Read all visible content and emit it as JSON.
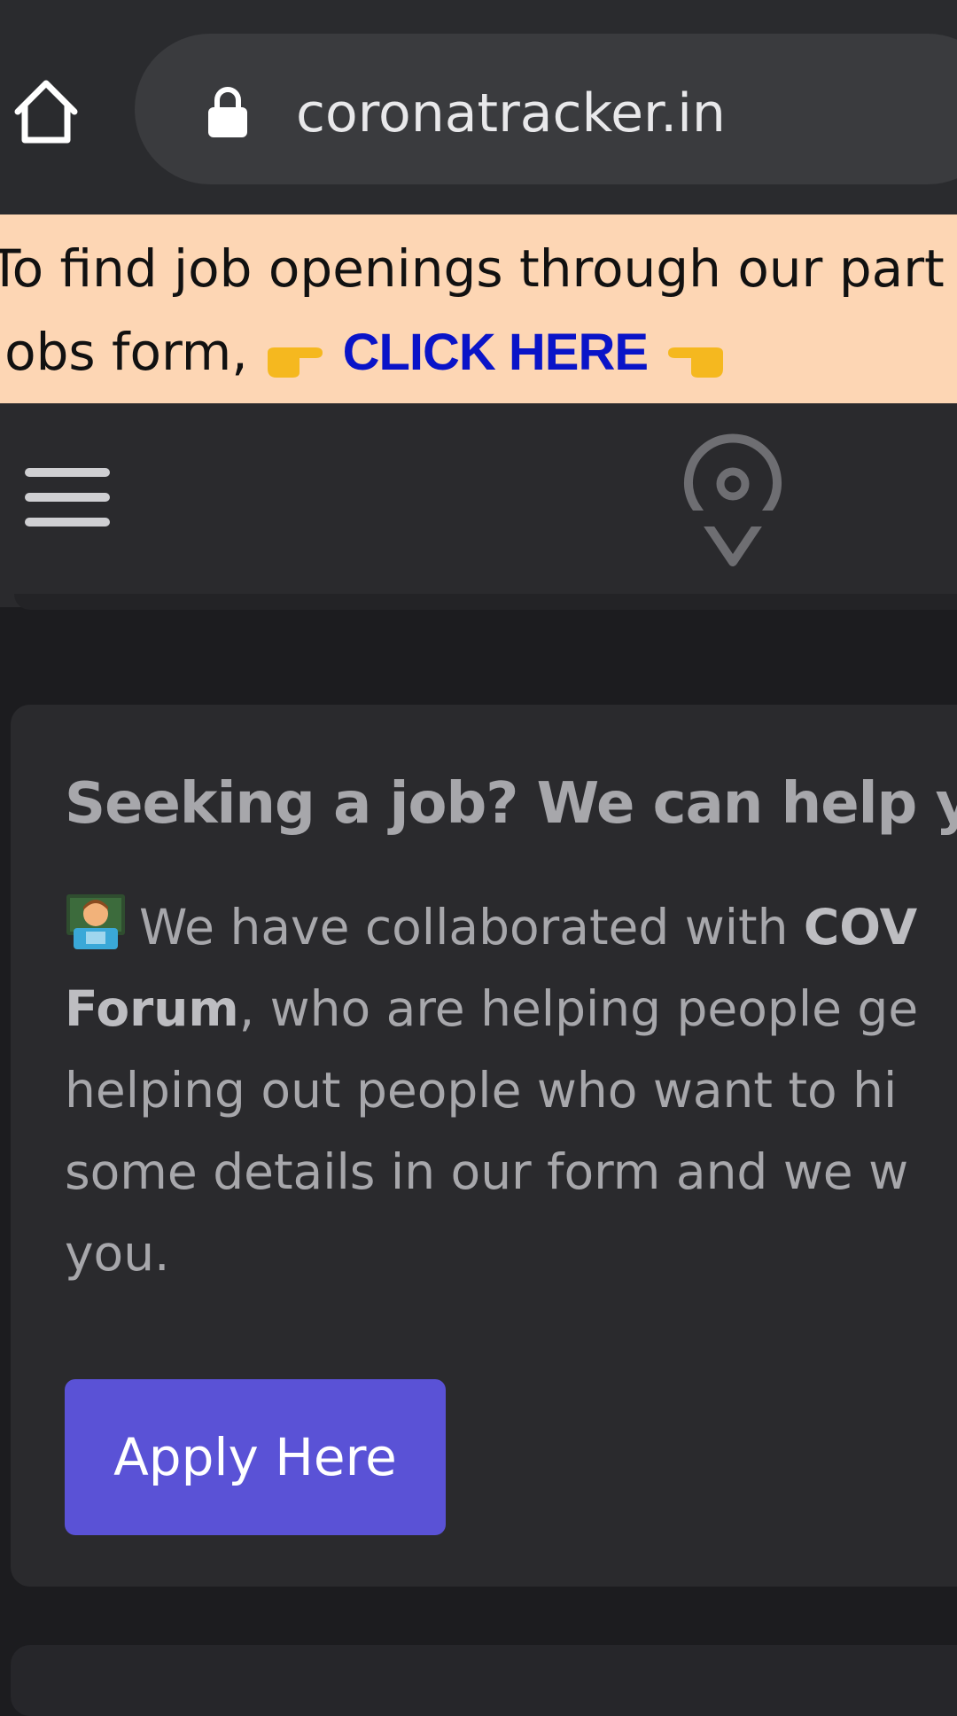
{
  "browser": {
    "url": "coronatracker.in"
  },
  "banner": {
    "line1": "To find job openings through our part",
    "line2_prefix": "Jobs form,",
    "cta_label": "CLICK HERE",
    "background_color": "#fdd6b4",
    "cta_color": "#0a14c8"
  },
  "card": {
    "title": "Seeking a job? We can help y",
    "body": {
      "line1_text": "We have collaborated with ",
      "line1_bold": "COV",
      "line2_bold": "Forum",
      "line2_text": ", who are helping people ge",
      "line3": "helping out people who want to hi",
      "line4": "some details in our form and we w",
      "line5": "you."
    },
    "apply_label": "Apply Here",
    "apply_color": "#5a52d6"
  },
  "icons": {
    "home": "home-icon",
    "lock": "lock-icon",
    "menu": "menu-icon",
    "location": "location-pin-icon",
    "pointing_right": "hand-pointing-right-icon",
    "pointing_left": "hand-pointing-left-icon",
    "technologist": "technologist-emoji-icon"
  }
}
